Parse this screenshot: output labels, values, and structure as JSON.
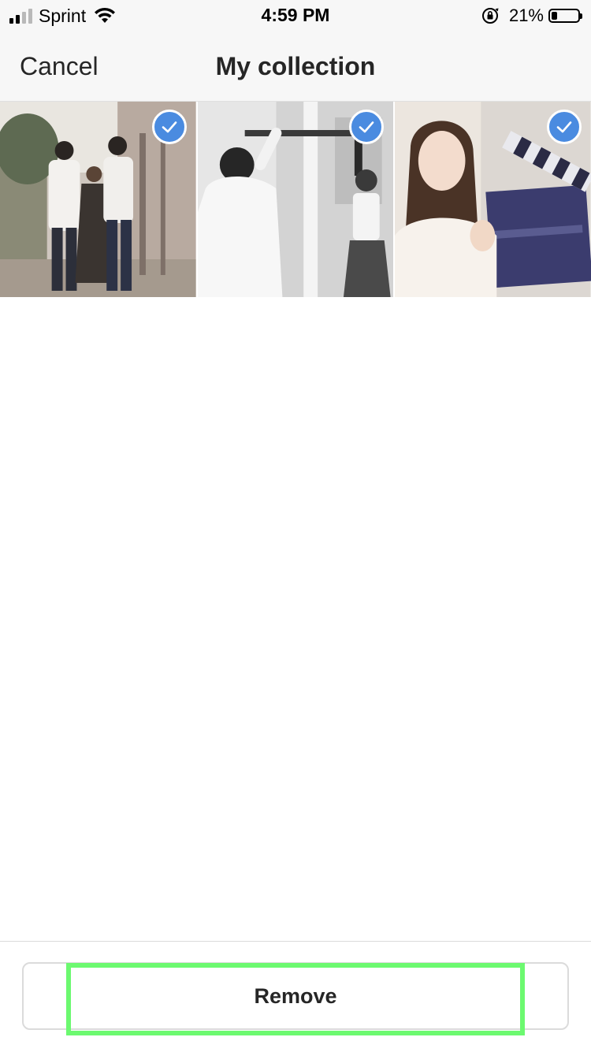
{
  "status_bar": {
    "carrier": "Sprint",
    "time": "4:59 PM",
    "battery_percent": "21%",
    "battery_level": 0.21,
    "icons": [
      "signal-icon",
      "wifi-icon",
      "orientation-lock-icon",
      "battery-icon"
    ]
  },
  "nav": {
    "cancel_label": "Cancel",
    "title": "My collection"
  },
  "grid": {
    "photos": [
      {
        "name": "photo-group-outdoor",
        "selected": true
      },
      {
        "name": "photo-bw-set",
        "selected": true
      },
      {
        "name": "photo-woman-clapperboard",
        "selected": true
      }
    ],
    "check_color": "#4a8be0"
  },
  "footer": {
    "remove_label": "Remove",
    "highlight_color": "#6cf970"
  }
}
